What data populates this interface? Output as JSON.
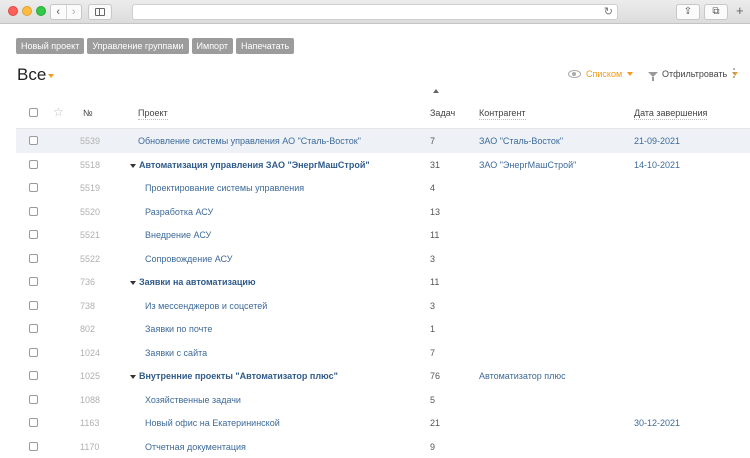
{
  "browser": {
    "back_icon": "‹",
    "forward_icon": "›",
    "reload_icon": "↻",
    "share_icon": "⇪",
    "tabs_icon": "⧉",
    "new_tab_icon": "+"
  },
  "toolbar": {
    "buttons": [
      "Новый проект",
      "Управление группами",
      "Импорт",
      "Напечатать"
    ]
  },
  "header": {
    "title": "Все",
    "view_label": "Списком",
    "filter_label": "Отфильтровать"
  },
  "table": {
    "columns": {
      "number": "№",
      "project": "Проект",
      "tasks": "Задач",
      "client": "Контрагент",
      "due": "Дата завершения"
    },
    "rows": [
      {
        "id": "5539",
        "name": "Обновление системы управления АО \"Сталь-Восток\"",
        "tasks": "7",
        "client": "ЗАО \"Сталь-Восток\"",
        "due": "21-09-2021",
        "group": false,
        "child": false,
        "highlight": true
      },
      {
        "id": "5518",
        "name": "Автоматизация управления ЗАО \"ЭнергМашСтрой\"",
        "tasks": "31",
        "client": "ЗАО \"ЭнергМашСтрой\"",
        "due": "14-10-2021",
        "group": true,
        "child": false,
        "highlight": false
      },
      {
        "id": "5519",
        "name": "Проектирование системы управления",
        "tasks": "4",
        "client": "",
        "due": "",
        "group": false,
        "child": true,
        "highlight": false
      },
      {
        "id": "5520",
        "name": "Разработка АСУ",
        "tasks": "13",
        "client": "",
        "due": "",
        "group": false,
        "child": true,
        "highlight": false
      },
      {
        "id": "5521",
        "name": "Внедрение АСУ",
        "tasks": "11",
        "client": "",
        "due": "",
        "group": false,
        "child": true,
        "highlight": false
      },
      {
        "id": "5522",
        "name": "Сопровождение АСУ",
        "tasks": "3",
        "client": "",
        "due": "",
        "group": false,
        "child": true,
        "highlight": false
      },
      {
        "id": "736",
        "name": "Заявки на автоматизацию",
        "tasks": "11",
        "client": "",
        "due": "",
        "group": true,
        "child": false,
        "highlight": false
      },
      {
        "id": "738",
        "name": "Из мессенджеров и соцсетей",
        "tasks": "3",
        "client": "",
        "due": "",
        "group": false,
        "child": true,
        "highlight": false
      },
      {
        "id": "802",
        "name": "Заявки по почте",
        "tasks": "1",
        "client": "",
        "due": "",
        "group": false,
        "child": true,
        "highlight": false
      },
      {
        "id": "1024",
        "name": "Заявки с сайта",
        "tasks": "7",
        "client": "",
        "due": "",
        "group": false,
        "child": true,
        "highlight": false
      },
      {
        "id": "1025",
        "name": "Внутренние проекты \"Автоматизатор плюс\"",
        "tasks": "76",
        "client": "Автоматизатор плюс",
        "due": "",
        "group": true,
        "child": false,
        "highlight": false
      },
      {
        "id": "1088",
        "name": "Хозяйственные задачи",
        "tasks": "5",
        "client": "",
        "due": "",
        "group": false,
        "child": true,
        "highlight": false
      },
      {
        "id": "1163",
        "name": "Новый офис на Екатерининской",
        "tasks": "21",
        "client": "",
        "due": "30-12-2021",
        "group": false,
        "child": true,
        "highlight": false
      },
      {
        "id": "1170",
        "name": "Отчетная документация",
        "tasks": "9",
        "client": "",
        "due": "",
        "group": false,
        "child": true,
        "highlight": false
      }
    ]
  },
  "colors": {
    "accent": "#f29a1e",
    "link": "#3d6a99",
    "button_bg": "#9c9c9c",
    "row_highlight": "#eef2f6"
  }
}
